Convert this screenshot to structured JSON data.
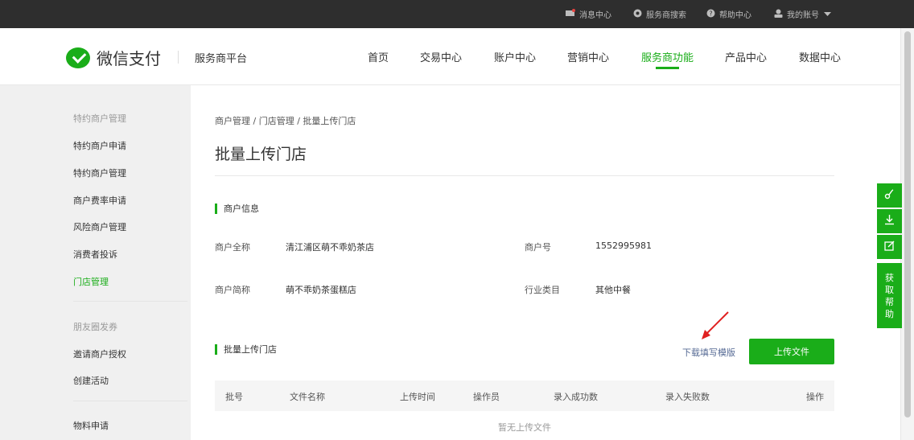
{
  "topbar": {
    "items": [
      {
        "label": "消息中心",
        "icon": "message-icon"
      },
      {
        "label": "服务商搜索",
        "icon": "search-icon"
      },
      {
        "label": "帮助中心",
        "icon": "help-icon"
      },
      {
        "label": "我的账号",
        "icon": "user-icon"
      }
    ]
  },
  "header": {
    "logo_text": "微信支付",
    "platform": "服务商平台",
    "nav": [
      "首页",
      "交易中心",
      "账户中心",
      "营销中心",
      "服务商功能",
      "产品中心",
      "数据中心"
    ],
    "active_nav": "服务商功能"
  },
  "sidebar": {
    "groups": [
      {
        "title": "特约商户管理",
        "items": [
          "特约商户申请",
          "特约商户管理",
          "商户费率申请",
          "风险商户管理",
          "消费者投诉",
          "门店管理"
        ]
      },
      {
        "title": "朋友圈发券",
        "items": [
          "邀请商户授权",
          "创建活动"
        ]
      },
      {
        "title": "",
        "items": [
          "物料申请"
        ]
      }
    ],
    "active_item": "门店管理"
  },
  "main": {
    "breadcrumb": "商户管理 / 门店管理 / 批量上传门店",
    "title": "批量上传门店",
    "merchant_section_title": "商户信息",
    "merchant_info": {
      "full_name_label": "商户全称",
      "full_name": "清江浦区萌不乖奶茶店",
      "id_label": "商户号",
      "id": "1552995981",
      "short_name_label": "商户简称",
      "short_name": "萌不乖奶茶蛋糕店",
      "category_label": "行业类目",
      "category": "其他中餐"
    },
    "upload_section_title": "批量上传门店",
    "download_template_link": "下载填写模版",
    "upload_button": "上传文件",
    "table_columns": [
      "批号",
      "文件名称",
      "上传时间",
      "操作员",
      "录入成功数",
      "录入失败数",
      "操作"
    ],
    "empty_text": "暂无上传文件"
  },
  "float_toolbar": {
    "icons": [
      "link-icon",
      "download-icon",
      "edit-icon"
    ],
    "help_chars": [
      "获",
      "取",
      "帮",
      "助"
    ]
  },
  "colors": {
    "accent": "#1aad19",
    "topbar": "#2e2e2e",
    "link": "#576b95",
    "annotation_arrow": "#e02020"
  }
}
